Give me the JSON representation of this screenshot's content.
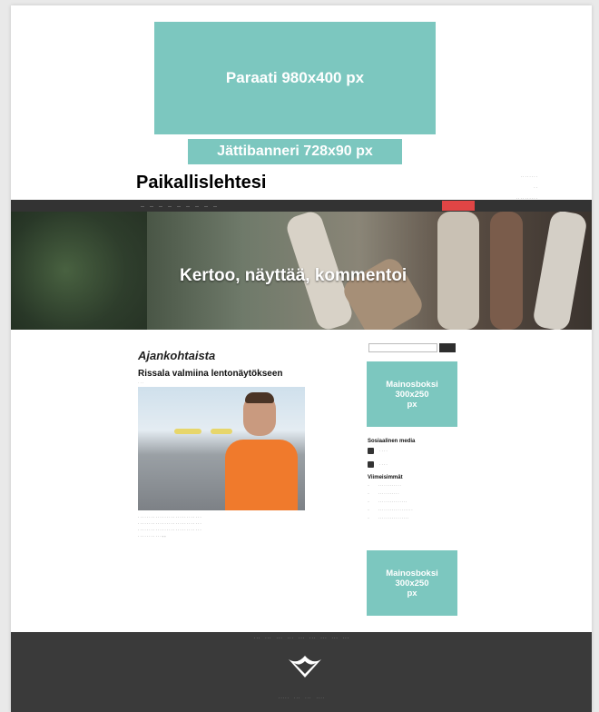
{
  "ads": {
    "parade": "Paraati 980x400 px",
    "giant_banner": "Jättibanneri 728x90 px",
    "box1": [
      "Mainosboksi",
      "300x250",
      "px"
    ],
    "box2": [
      "Mainosboksi",
      "300x250",
      "px"
    ]
  },
  "site": {
    "logo": "Paikallislehtesi"
  },
  "hero": {
    "tagline": "Kertoo, näyttää, kommentoi"
  },
  "main": {
    "section_title": "Ajankohtaista",
    "article_title": "Rissala valmiina lentonäytökseen"
  },
  "sidebar": {
    "social_heading": "Sosiaalinen media",
    "latest_heading": "Viimeisimmät"
  },
  "colors": {
    "ad": "#7cc7bf",
    "nav": "#333333",
    "cta": "#e04545",
    "footer": "#3a3a3a"
  }
}
